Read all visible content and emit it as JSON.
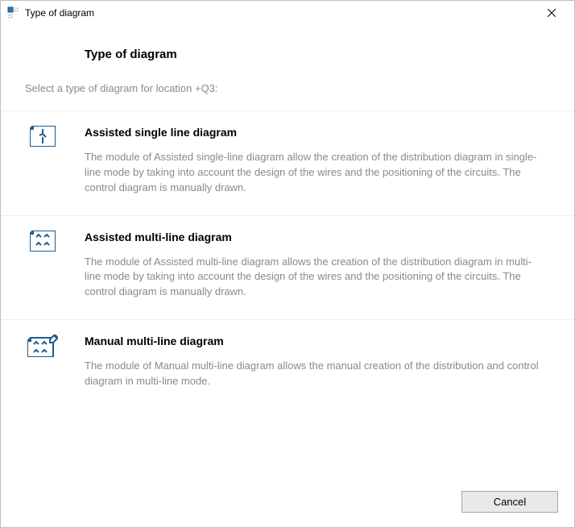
{
  "window": {
    "title": "Type of diagram"
  },
  "header": {
    "title": "Type of diagram",
    "subtitle": "Select a type of diagram for location +Q3:"
  },
  "options": [
    {
      "icon": "single-line-diagram-icon",
      "title": "Assisted single line diagram",
      "description": "The module of Assisted single-line diagram allow the creation of the distribution diagram in single-line mode by taking into account the design of the wires and the positioning of the circuits. The control diagram is manually drawn."
    },
    {
      "icon": "multi-line-diagram-icon",
      "title": "Assisted multi-line diagram",
      "description": "The module of Assisted multi-line diagram allows the creation of the distribution diagram in multi-line mode by taking into account the design of the wires and the positioning of the circuits. The control diagram is manually drawn."
    },
    {
      "icon": "manual-multi-line-diagram-icon",
      "title": "Manual multi-line diagram",
      "description": "The module of Manual multi-line diagram allows the manual creation of the distribution and control diagram in multi-line mode."
    }
  ],
  "footer": {
    "cancel": "Cancel"
  }
}
